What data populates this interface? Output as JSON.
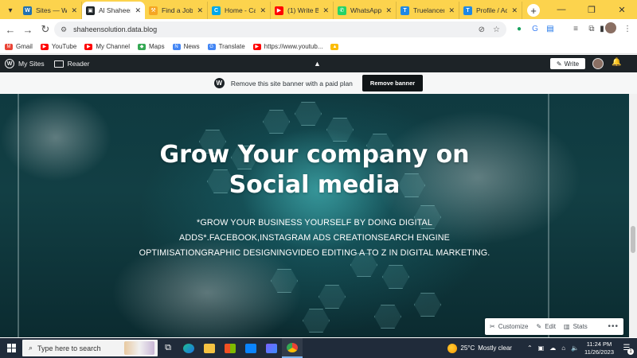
{
  "browser": {
    "tabs": [
      {
        "title": "Sites — Wor",
        "favicon_color": "#2271b1",
        "favicon_glyph": "W"
      },
      {
        "title": "Al Shaheen",
        "favicon_color": "#1d2327",
        "favicon_glyph": "▣",
        "active": true
      },
      {
        "title": "Find a Job -",
        "favicon_color": "#f5a623",
        "favicon_glyph": "⚒"
      },
      {
        "title": "Home - Can",
        "favicon_color": "#00a8e8",
        "favicon_glyph": "C"
      },
      {
        "title": "(1) Write Be",
        "favicon_color": "#ff0000",
        "favicon_glyph": "▶"
      },
      {
        "title": "WhatsApp",
        "favicon_color": "#25d366",
        "favicon_glyph": "✆"
      },
      {
        "title": "Truelancer |",
        "favicon_color": "#1e88e5",
        "favicon_glyph": "T"
      },
      {
        "title": "Profile / Acc",
        "favicon_color": "#1e88e5",
        "favicon_glyph": "T"
      }
    ],
    "url": "shaheensolution.data.blog",
    "bookmarks": [
      {
        "label": "Gmail",
        "color": "#ea4335",
        "glyph": "M"
      },
      {
        "label": "YouTube",
        "color": "#ff0000",
        "glyph": "▶"
      },
      {
        "label": "My Channel",
        "color": "#ff0000",
        "glyph": "▶"
      },
      {
        "label": "Maps",
        "color": "#34a853",
        "glyph": "◆"
      },
      {
        "label": "News",
        "color": "#4285f4",
        "glyph": "N"
      },
      {
        "label": "Translate",
        "color": "#4285f4",
        "glyph": "G"
      },
      {
        "label": "https://www.youtub...",
        "color": "#ff0000",
        "glyph": "▶"
      },
      {
        "label": "",
        "color": "#fbbc04",
        "glyph": "▲"
      }
    ]
  },
  "wp_admin_bar": {
    "my_sites": "My Sites",
    "reader": "Reader",
    "write": "Write"
  },
  "site_banner": {
    "text": "Remove this site banner with a paid plan",
    "button": "Remove banner"
  },
  "hero": {
    "title": "Grow Your company on Social media",
    "description": "*GROW YOUR BUSINESS YOURSELF BY DOING DIGITAL ADDS*.FACEBOOK,INSTAGRAM ADS CREATIONSEARCH ENGINE OPTIMISATIONGRAPHIC DESIGNINGVIDEO EDITING A TO Z IN DIGITAL MARKETING."
  },
  "customize_bar": {
    "customize": "Customize",
    "edit": "Edit",
    "stats": "Stats"
  },
  "taskbar": {
    "search_placeholder": "Type here to search",
    "temperature": "25°C",
    "weather": "Mostly clear",
    "time": "11:24 PM",
    "date": "11/26/2023",
    "notification_count": "1"
  }
}
